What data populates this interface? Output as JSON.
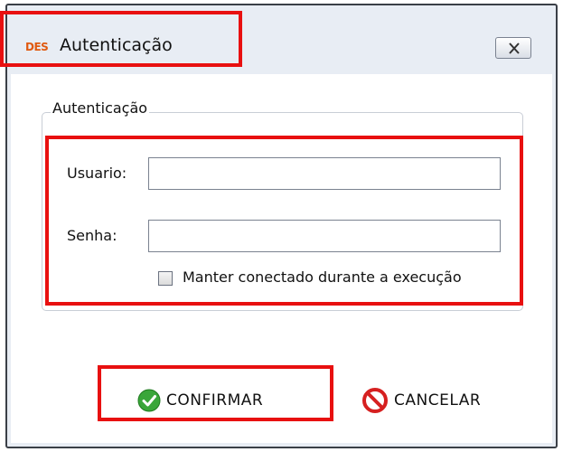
{
  "window": {
    "app_logo": "DES",
    "title": "Autenticação"
  },
  "group": {
    "title": "Autenticação"
  },
  "form": {
    "user_label": "Usuario:",
    "user_value": "",
    "password_label": "Senha:",
    "password_value": "",
    "keep_connected_label": "Manter conectado durante a execução",
    "keep_connected_checked": false
  },
  "buttons": {
    "confirm_label": "CONFIRMAR",
    "cancel_label": "CANCELAR"
  },
  "colors": {
    "highlight": "#e81010",
    "confirm_icon": "#3aa63a",
    "cancel_icon": "#d62020"
  }
}
